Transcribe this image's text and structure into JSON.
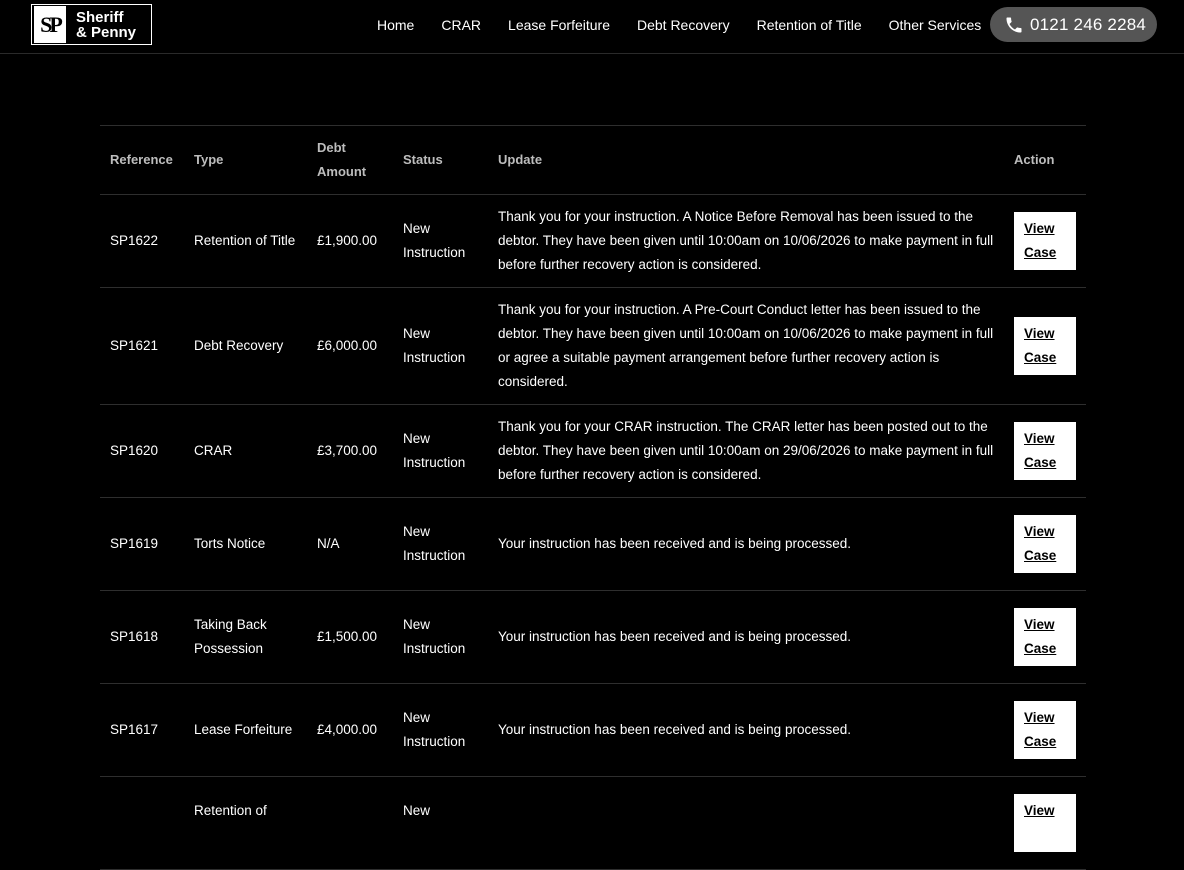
{
  "header": {
    "logo_mark": "SP",
    "logo_line1": "Sheriff",
    "logo_line2": "& Penny",
    "nav": [
      {
        "label": "Home"
      },
      {
        "label": "CRAR"
      },
      {
        "label": "Lease Forfeiture"
      },
      {
        "label": "Debt Recovery"
      },
      {
        "label": "Retention of Title"
      },
      {
        "label": "Other Services"
      }
    ],
    "phone": "0121 246 2284",
    "phone_icon": "phone-icon"
  },
  "table": {
    "columns": {
      "reference": "Reference",
      "type": "Type",
      "debt_amount": "Debt Amount",
      "status": "Status",
      "update": "Update",
      "action": "Action"
    },
    "rows": [
      {
        "reference": "SP1622",
        "type": "Retention of Title",
        "amount": "£1,900.00",
        "status": "New Instruction",
        "update": "Thank you for your instruction. A Notice Before Removal has been issued to the debtor. They have been given until 10:00am on 10/06/2026 to make payment in full before further recovery action is considered.",
        "action": "View Case"
      },
      {
        "reference": "SP1621",
        "type": "Debt Recovery",
        "amount": "£6,000.00",
        "status": "New Instruction",
        "update": "Thank you for your instruction. A Pre-Court Conduct letter has been issued to the debtor. They have been given until 10:00am on 10/06/2026 to make payment in full or agree a suitable payment arrangement before further recovery action is considered.",
        "action": "View Case"
      },
      {
        "reference": "SP1620",
        "type": "CRAR",
        "amount": "£3,700.00",
        "status": "New Instruction",
        "update": "Thank you for your CRAR instruction. The CRAR letter has been posted out to the debtor. They have been given until 10:00am on 29/06/2026 to make payment in full before further recovery action is considered.",
        "action": "View Case"
      },
      {
        "reference": "SP1619",
        "type": "Torts Notice",
        "amount": "N/A",
        "status": "New Instruction",
        "update": "Your instruction has been received and is being processed.",
        "action": "View Case"
      },
      {
        "reference": "SP1618",
        "type": "Taking Back Possession",
        "amount": "£1,500.00",
        "status": "New Instruction",
        "update": "Your instruction has been received and is being processed.",
        "action": "View Case"
      },
      {
        "reference": "SP1617",
        "type": "Lease Forfeiture",
        "amount": "£4,000.00",
        "status": "New Instruction",
        "update": "Your instruction has been received and is being processed.",
        "action": "View Case"
      },
      {
        "reference": "",
        "type": "Retention of",
        "amount": "",
        "status": "New",
        "update": "",
        "action": "View"
      }
    ]
  }
}
